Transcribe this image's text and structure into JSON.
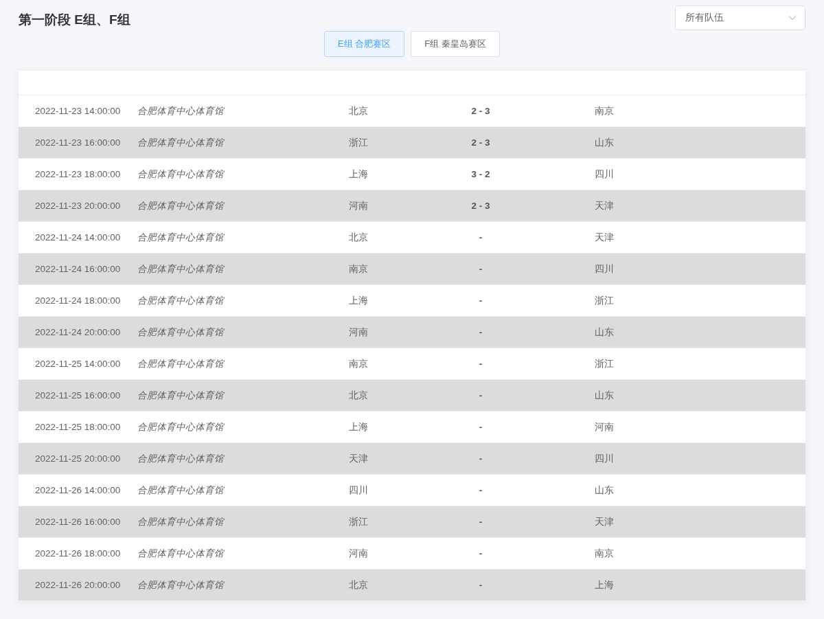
{
  "title": "第一阶段 E组、F组",
  "team_filter": {
    "value": "所有队伍"
  },
  "tabs": [
    {
      "label": "E组 合肥赛区",
      "selected": true
    },
    {
      "label": "F组 秦皇岛赛区",
      "selected": false
    }
  ],
  "matches": [
    {
      "time": "2022-11-23 14:00:00",
      "venue": "合肥体育中心体育馆",
      "home": "北京",
      "score": "2 - 3",
      "away": "南京"
    },
    {
      "time": "2022-11-23 16:00:00",
      "venue": "合肥体育中心体育馆",
      "home": "浙江",
      "score": "2 - 3",
      "away": "山东"
    },
    {
      "time": "2022-11-23 18:00:00",
      "venue": "合肥体育中心体育馆",
      "home": "上海",
      "score": "3 - 2",
      "away": "四川"
    },
    {
      "time": "2022-11-23 20:00:00",
      "venue": "合肥体育中心体育馆",
      "home": "河南",
      "score": "2 - 3",
      "away": "天津"
    },
    {
      "time": "2022-11-24 14:00:00",
      "venue": "合肥体育中心体育馆",
      "home": "北京",
      "score": "-",
      "away": "天津"
    },
    {
      "time": "2022-11-24 16:00:00",
      "venue": "合肥体育中心体育馆",
      "home": "南京",
      "score": "-",
      "away": "四川"
    },
    {
      "time": "2022-11-24 18:00:00",
      "venue": "合肥体育中心体育馆",
      "home": "上海",
      "score": "-",
      "away": "浙江"
    },
    {
      "time": "2022-11-24 20:00:00",
      "venue": "合肥体育中心体育馆",
      "home": "河南",
      "score": "-",
      "away": "山东"
    },
    {
      "time": "2022-11-25 14:00:00",
      "venue": "合肥体育中心体育馆",
      "home": "南京",
      "score": "-",
      "away": "浙江"
    },
    {
      "time": "2022-11-25 16:00:00",
      "venue": "合肥体育中心体育馆",
      "home": "北京",
      "score": "-",
      "away": "山东"
    },
    {
      "time": "2022-11-25 18:00:00",
      "venue": "合肥体育中心体育馆",
      "home": "上海",
      "score": "-",
      "away": "河南"
    },
    {
      "time": "2022-11-25 20:00:00",
      "venue": "合肥体育中心体育馆",
      "home": "天津",
      "score": "-",
      "away": "四川"
    },
    {
      "time": "2022-11-26 14:00:00",
      "venue": "合肥体育中心体育馆",
      "home": "四川",
      "score": "-",
      "away": "山东"
    },
    {
      "time": "2022-11-26 16:00:00",
      "venue": "合肥体育中心体育馆",
      "home": "浙江",
      "score": "-",
      "away": "天津"
    },
    {
      "time": "2022-11-26 18:00:00",
      "venue": "合肥体育中心体育馆",
      "home": "河南",
      "score": "-",
      "away": "南京"
    },
    {
      "time": "2022-11-26 20:00:00",
      "venue": "合肥体育中心体育馆",
      "home": "北京",
      "score": "-",
      "away": "上海"
    }
  ]
}
